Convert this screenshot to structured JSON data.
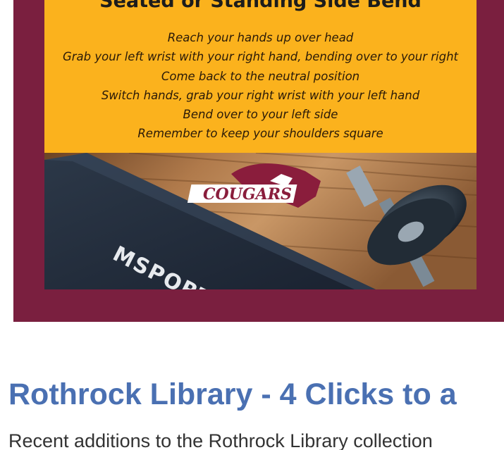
{
  "card": {
    "title": "Seated or Standing Side Bend",
    "steps": [
      "Reach your hands up over head",
      "Grab your left wrist with your right hand, bending over to your right",
      "Come back to the neutral position",
      "Switch hands, grab your right wrist with your left hand",
      "Bend over to your left side",
      "Remember to keep your shoulders square"
    ],
    "logo_text": "COUGARS",
    "mat_text": "MSPORT",
    "colors": {
      "frame": "#7a1f3f",
      "panel": "#fbb21d",
      "logo": "#8a1d3c"
    }
  },
  "article": {
    "title": "Rothrock Library - 4 Clicks to a",
    "excerpt": "Recent additions to the Rothrock Library collection"
  }
}
